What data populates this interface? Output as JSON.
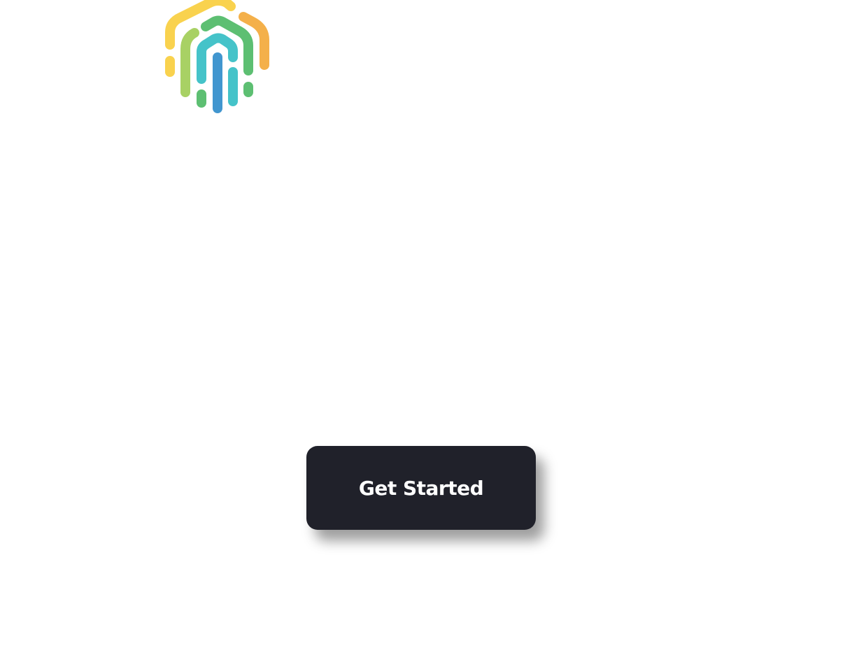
{
  "logo": {
    "icon": "fingerprint-logo-icon",
    "colors": {
      "yellow": "#f9d24e",
      "orange": "#f4b04a",
      "light_green": "#a8d164",
      "green": "#5dbf72",
      "teal": "#45c3c9",
      "blue": "#4196cf"
    }
  },
  "cta": {
    "label": "Get Started",
    "background": "#20212a",
    "text_color": "#ffffff"
  }
}
